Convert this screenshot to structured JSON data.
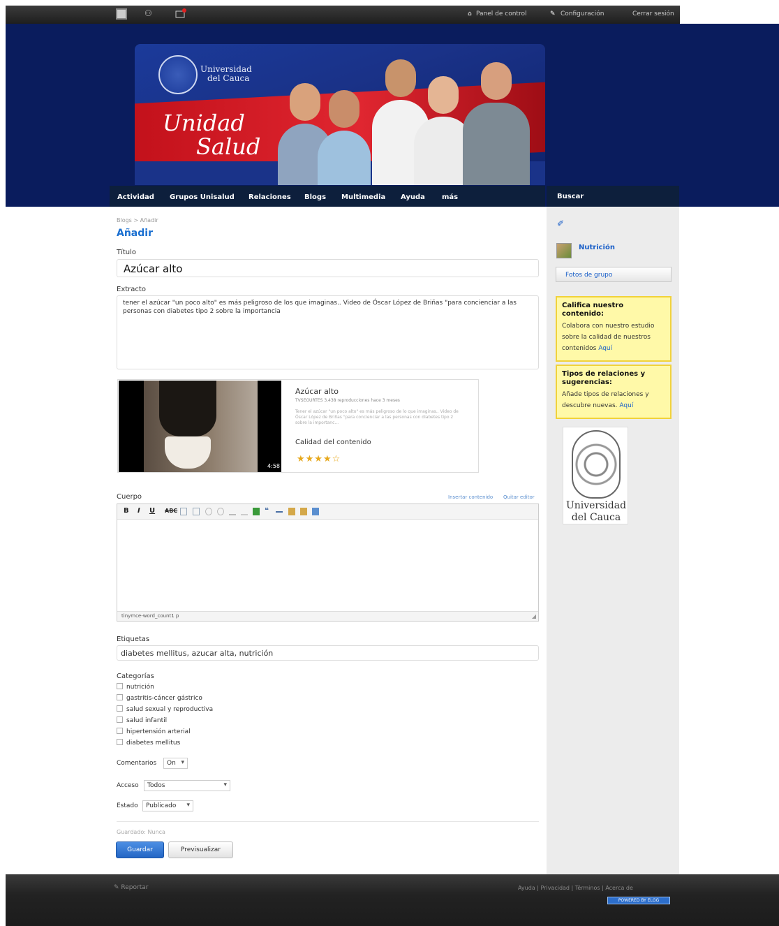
{
  "topbar": {
    "icons": [
      "profile-icon",
      "friends-icon",
      "messages-icon"
    ],
    "links": [
      "Panel de control",
      "Configuración",
      "Cerrar sesión"
    ]
  },
  "banner": {
    "university_line1": "Universidad",
    "university_line2": "del Cauca",
    "brand_line1": "Unidad",
    "brand_line2": "Salud"
  },
  "nav": {
    "items": [
      "Actividad",
      "Grupos Unisalud",
      "Relaciones",
      "Blogs",
      "Multimedia",
      "Ayuda",
      "más"
    ],
    "search_label": "Buscar"
  },
  "breadcrumb": "Blogs > Añadir",
  "page_title": "Añadir",
  "form": {
    "title_label": "Título",
    "title_value": "Azúcar alto",
    "excerpt_label": "Extracto",
    "excerpt_value": "tener el azúcar \"un poco alto\" es más peligroso de los que imaginas.. Video de Óscar López de Briñas \"para concienciar a las personas con diabetes tipo 2 sobre la importancia",
    "body_label": "Cuerpo",
    "insert_content": "Insertar contenido",
    "remove_editor": "Quitar editor",
    "editor_status": "tinymce-word_count1 p",
    "tags_label": "Etiquetas",
    "tags_value": "diabetes mellitus, azucar alta, nutrición",
    "categories_label": "Categorías",
    "categories": [
      "nutrición",
      "gastritis-cáncer gástrico",
      "salud sexual y reproductiva",
      "salud infantil",
      "hipertensión arterial",
      "diabetes mellitus"
    ],
    "comments_label": "Comentarios",
    "comments_value": "On",
    "access_label": "Acceso",
    "access_value": "Todos",
    "status_label": "Estado",
    "status_value": "Publicado",
    "saved_text": "Guardado: Nunca",
    "save_button": "Guardar",
    "preview_button": "Previsualizar"
  },
  "video": {
    "title": "Azúcar alto",
    "meta": "TVSEGURTES   3.438 reproducciones   hace 3 meses",
    "description": "Tener el azúcar \"un poco alto\" es más peligroso de lo que imaginas.. Video de Óscar López de Briñas \"para concienciar a las personas con diabetes tipo 2 sobre la importanc...",
    "duration": "4:58",
    "quality_label": "Calidad del contenido",
    "stars": "★★★★☆",
    "rating": 4.5
  },
  "sidebar": {
    "group_name": "Nutrición",
    "group_photos_button": "Fotos de grupo",
    "box1_title": "Califica nuestro contenido:",
    "box1_text": "Colabora con nuestro estudio sobre la calidad de nuestros contenidos",
    "box1_link": "Aquí",
    "box2_title": "Tipos de relaciones y sugerencias:",
    "box2_text": "Añade tipos de relaciones y descubre nuevas.",
    "box2_link": "Aquí",
    "crest_line1": "Universidad",
    "crest_line2": "del Cauca"
  },
  "footer": {
    "report": "Reportar",
    "links": "Ayuda | Privacidad | Términos | Acerca de",
    "powered": "POWERED BY ELGG"
  }
}
